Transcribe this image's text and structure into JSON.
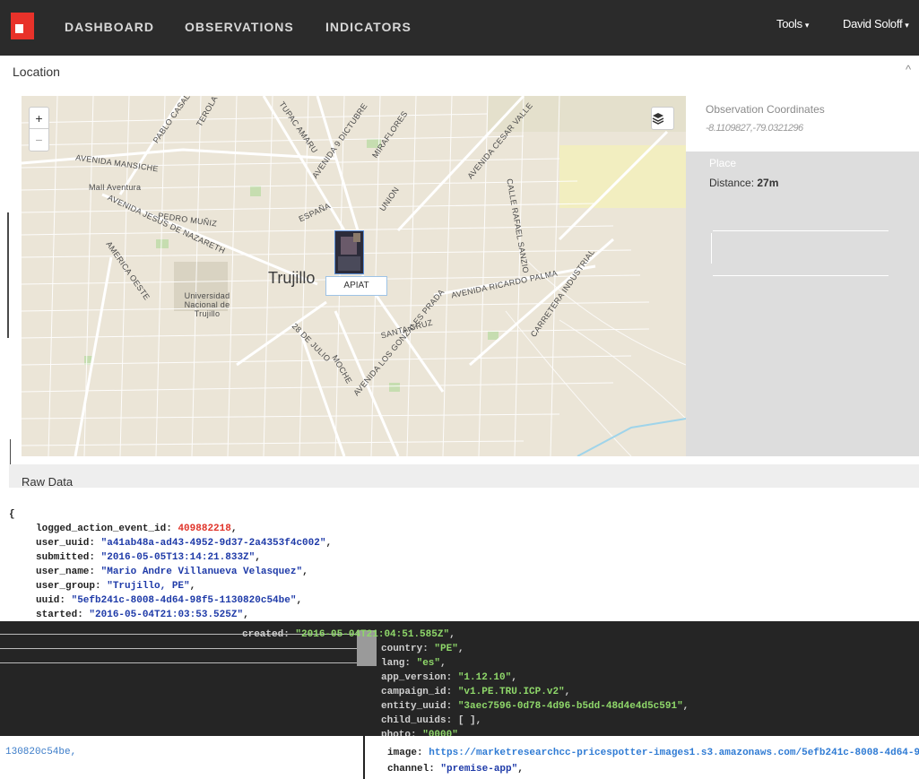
{
  "nav": {
    "items": [
      "DASHBOARD",
      "OBSERVATIONS",
      "INDICATORS"
    ],
    "tools_label": "Tools",
    "user_label": "David Soloff"
  },
  "location": {
    "title": "Location",
    "collapse_icon": "chevron-up-icon"
  },
  "map": {
    "city": "Trujillo",
    "marker_label": "APIAT",
    "zoom_in": "+",
    "zoom_out": "−",
    "streets": [
      "AVENIDA MANSICHE",
      "Mall Aventura",
      "PABLO CASAL",
      "TEROLA",
      "TUPAC AMARU",
      "AVENIDA 9 DICTUBRE",
      "MIRAFLORES",
      "AVENIDA CESAR VALLE",
      "ESPAÑA",
      "UNION",
      "PEDRO MUÑIZ",
      "AVENIDA JESUS DE NAZARETH",
      "AMERICA OESTE",
      "Universidad Nacional de Trujillo",
      "CALLE RAFAEL SANZIO",
      "AVENIDA RICARDO PALMA",
      "CARRETERA INDUSTRIAL",
      "SANTA CRUZ",
      "28 DE JULIO",
      "AVENIDA LOS GONZALES PRADA",
      "MOCHE"
    ]
  },
  "observation": {
    "coordinates_label": "Observation Coordinates",
    "coordinates_value": "-8.1109827,-79.0321296",
    "place_label": "Place",
    "distance_label": "Distance:",
    "distance_value": "27m"
  },
  "raw_data": {
    "title": "Raw Data",
    "open_brace": "{",
    "fields": [
      {
        "key": "logged_action_event_id",
        "value": "409882218",
        "kind": "number"
      },
      {
        "key": "user_uuid",
        "value": "\"a41ab48a-ad43-4952-9d37-2a4353f4c002\"",
        "kind": "string"
      },
      {
        "key": "submitted",
        "value": "\"2016-05-05T13:14:21.833Z\"",
        "kind": "string"
      },
      {
        "key": "user_name",
        "value": "\"Mario Andre Villanueva Velasquez\"",
        "kind": "string"
      },
      {
        "key": "user_group",
        "value": "\"Trujillo, PE\"",
        "kind": "string"
      },
      {
        "key": "uuid",
        "value": "\"5efb241c-8008-4d64-98f5-1130820c54be\"",
        "kind": "string"
      },
      {
        "key": "started",
        "value": "\"2016-05-04T21:03:53.525Z\"",
        "kind": "string"
      }
    ],
    "overlay_fields": [
      {
        "key": "created",
        "value": "\"2016-05-04T21:04:51.585Z\""
      },
      {
        "key": "country",
        "value": "\"PE\""
      },
      {
        "key": "lang",
        "value": "\"es\""
      },
      {
        "key": "app_version",
        "value": "\"1.12.10\""
      },
      {
        "key": "campaign_id",
        "value": "\"v1.PE.TRU.ICP.v2\""
      },
      {
        "key": "entity_uuid",
        "value": "\"3aec7596-0d78-4d96-b5dd-48d4e4d5c591\""
      },
      {
        "key": "child_uuids",
        "value": "[ ]"
      },
      {
        "key": "photo",
        "value": "\"0000\""
      }
    ],
    "uuid_tail": "130820c54be",
    "image_key": "image",
    "image_url": "https://marketresearchcc-pricespotter-images1.s3.amazonaws.com/5efb241c-8008-4d64-98f5",
    "channel_key": "channel",
    "channel_value": "\"premise-app\""
  }
}
